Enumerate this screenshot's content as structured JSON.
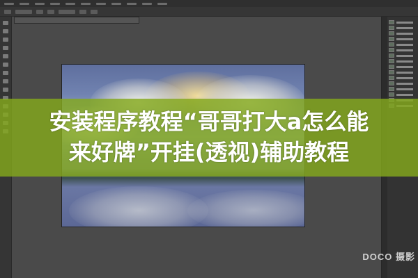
{
  "app": {
    "menu_count": 11,
    "layers_count": 16
  },
  "canvas_image": {
    "subject": "clouds-over-mountains"
  },
  "banner": {
    "color": "#84a81c",
    "line1": "安装程序教程“哥哥打大a怎么能",
    "line2": "来好牌”开挂(透视)辅助教程"
  },
  "watermark": {
    "text": "DOCO 摄影"
  },
  "icons": {
    "tools": "tool-icon",
    "layer_thumb": "layer-thumbnail-icon"
  }
}
